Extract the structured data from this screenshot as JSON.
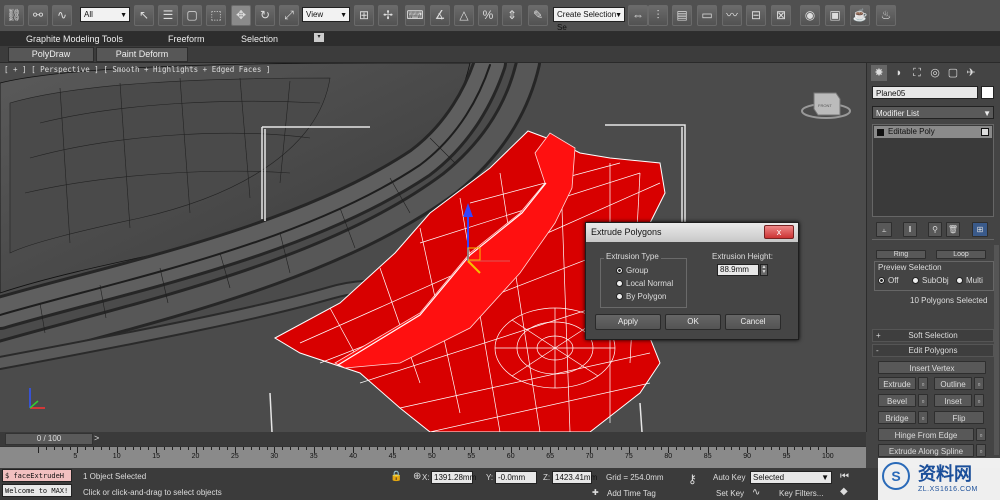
{
  "toolbar": {
    "filter_value": "All",
    "view_value": "View",
    "selection_set_placeholder": "Create Selection Se"
  },
  "ribbon": {
    "tabs": [
      {
        "label": "Graphite Modeling Tools"
      },
      {
        "label": "Freeform"
      },
      {
        "label": "Selection"
      }
    ],
    "subtabs": [
      {
        "label": "PolyDraw"
      },
      {
        "label": "Paint Deform"
      }
    ]
  },
  "viewport": {
    "label": "[ + ] [ Perspective ] [ Smooth + Highlights + Edged Faces ]",
    "viewcube_label": "FRONT"
  },
  "dialog": {
    "title": "Extrude Polygons",
    "close_label": "x",
    "extrusion_type_label": "Extrusion Type",
    "options": [
      {
        "label": "Group",
        "selected": true
      },
      {
        "label": "Local Normal",
        "selected": false
      },
      {
        "label": "By Polygon",
        "selected": false
      }
    ],
    "height_label": "Extrusion Height:",
    "height_value": "88.9mm",
    "apply_label": "Apply",
    "ok_label": "OK",
    "cancel_label": "Cancel"
  },
  "command_panel": {
    "object_name": "Plane05",
    "modifier_list_label": "Modifier List",
    "stack_item": "Editable Poly",
    "ring_label": "Ring",
    "loop_label": "Loop",
    "preview_selection_label": "Preview Selection",
    "preview_options": [
      {
        "label": "Off",
        "selected": true
      },
      {
        "label": "SubObj",
        "selected": false
      },
      {
        "label": "Multi",
        "selected": false
      }
    ],
    "selection_info": "10 Polygons Selected",
    "soft_selection_label": "Soft Selection",
    "edit_polygons_label": "Edit Polygons",
    "insert_vertex_label": "Insert Vertex",
    "extrude_label": "Extrude",
    "outline_label": "Outline",
    "bevel_label": "Bevel",
    "inset_label": "Inset",
    "bridge_label": "Bridge",
    "flip_label": "Flip",
    "hinge_label": "Hinge From Edge",
    "extrude_spline_label": "Extrude Along Spline"
  },
  "timeline": {
    "frame_label": "0 / 100",
    "ticks": [
      "5",
      "10",
      "15",
      "20",
      "25",
      "30",
      "35",
      "40",
      "45",
      "50",
      "55",
      "60",
      "65",
      "70",
      "75",
      "80",
      "85",
      "90",
      "95",
      "100"
    ]
  },
  "status": {
    "maxscript_line1": "$ faceExtrudeH",
    "maxscript_line2": "Welcome to MAX!",
    "selected_text": "1 Object Selected",
    "prompt_text": "Click or click-and-drag to select objects",
    "x_label": "X:",
    "x_value": "1391.28mm",
    "y_label": "Y:",
    "y_value": "-0.0mm",
    "z_label": "Z:",
    "z_value": "1423.41mm",
    "grid_text": "Grid = 254.0mm",
    "add_time_tag": "Add Time Tag",
    "auto_key": "Auto Key",
    "selected_dropdown": "Selected",
    "set_key": "Set Key",
    "key_filters": "Key Filters..."
  },
  "watermark": {
    "text": "资料网",
    "url": "ZL.XS1616.COM"
  }
}
